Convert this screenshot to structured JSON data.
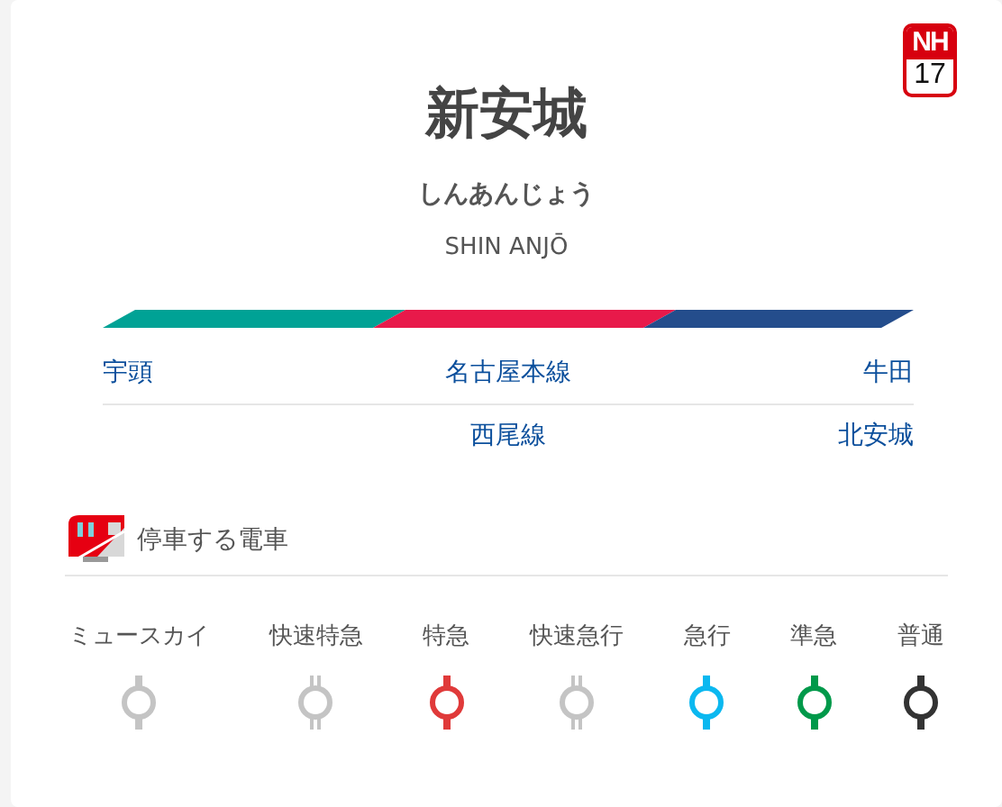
{
  "station_number": {
    "line": "NH",
    "number": "17"
  },
  "station": {
    "name": "新安城",
    "kana": "しんあんじょう",
    "romaji": "SHIN ANJŌ"
  },
  "line_bar": [
    {
      "color": "#00a295"
    },
    {
      "color": "#e8194a"
    },
    {
      "color": "#244d8c"
    }
  ],
  "routes": [
    {
      "previous": "宇頭",
      "line": "名古屋本線",
      "next": "牛田"
    },
    {
      "line": "西尾線",
      "next": "北安城"
    }
  ],
  "trains": {
    "heading": "停車する電車",
    "types": [
      {
        "name": "ミュースカイ",
        "kind": "no-service",
        "color": "#c4c4c4"
      },
      {
        "name": "快速特急",
        "kind": "pass",
        "color": "#c4c4c4"
      },
      {
        "name": "特急",
        "kind": "stop",
        "color": "#e03a3a"
      },
      {
        "name": "快速急行",
        "kind": "pass",
        "color": "#c4c4c4"
      },
      {
        "name": "急行",
        "kind": "stop",
        "color": "#0bb8f0"
      },
      {
        "name": "準急",
        "kind": "stop",
        "color": "#00994a"
      },
      {
        "name": "普通",
        "kind": "stop",
        "color": "#333333"
      }
    ]
  }
}
